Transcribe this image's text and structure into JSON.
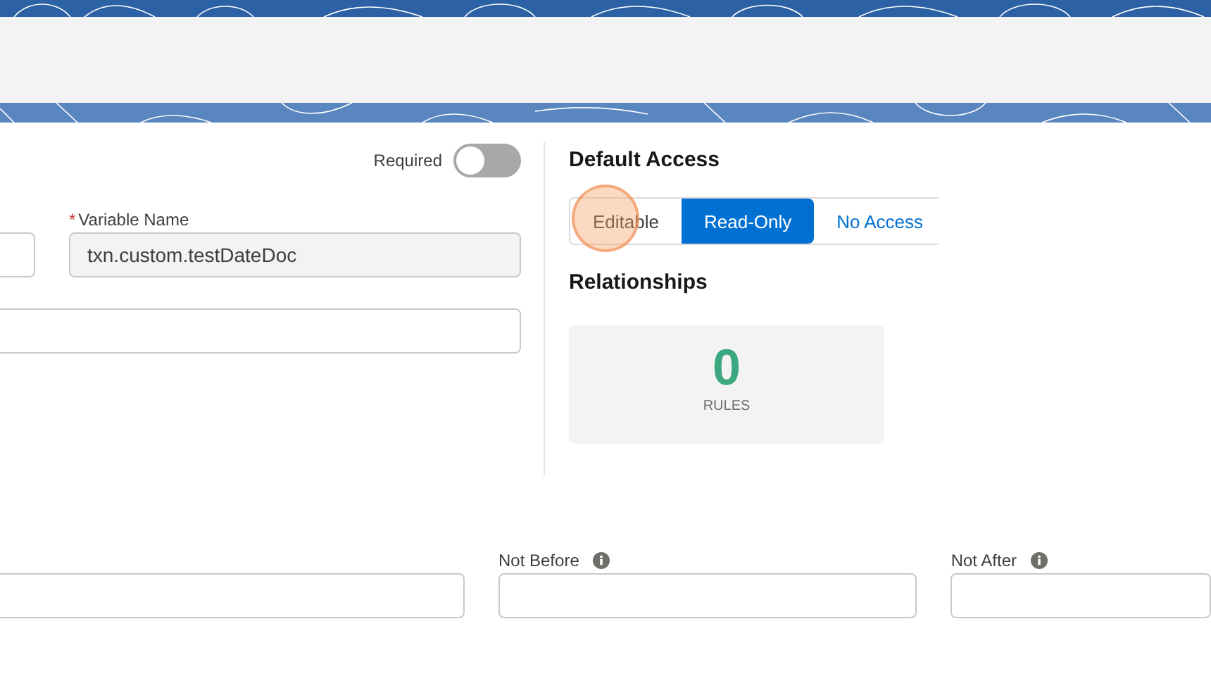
{
  "required_toggle": {
    "label": "Required",
    "on": false
  },
  "fields_row_1": [
    {
      "kind": "input"
    },
    {
      "kind": "readonly",
      "required_mark": "*",
      "label": "Variable Name",
      "value": "txn.custom.testDateDoc"
    }
  ],
  "fields_row_2": [
    {
      "kind": "input"
    }
  ],
  "default_access": {
    "title": "Default Access",
    "options": [
      {
        "label": "Editable",
        "selected": false,
        "highlighted": true
      },
      {
        "label": "Read-Only",
        "selected": true,
        "highlighted": false
      },
      {
        "label": "No Access",
        "selected": false,
        "highlighted": false
      }
    ]
  },
  "relationships": {
    "title": "Relationships",
    "count": "0",
    "unit": "RULES"
  },
  "date_fields": [
    {
      "kind": "input"
    },
    {
      "kind": "input",
      "label": "Not Before",
      "info": true
    },
    {
      "kind": "input",
      "label": "Not After",
      "info": true
    }
  ]
}
